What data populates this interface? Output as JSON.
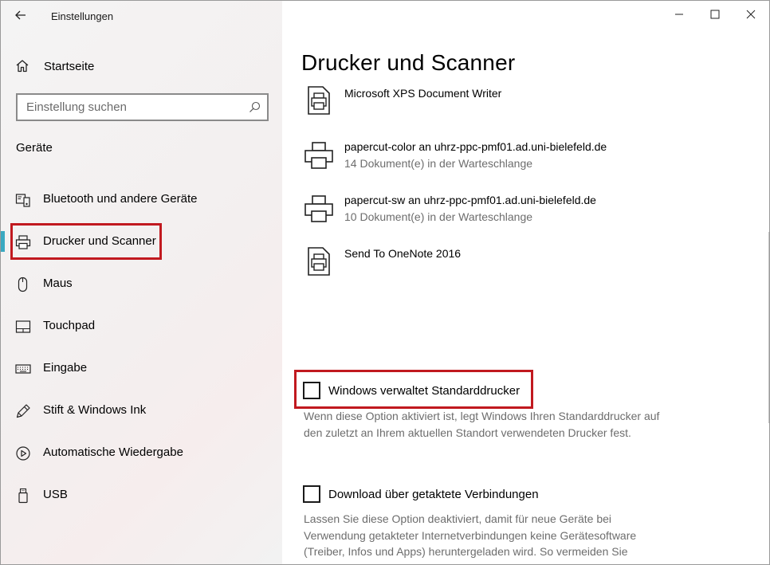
{
  "app": {
    "title": "Einstellungen",
    "back_icon": "arrow-left-icon"
  },
  "sidebar": {
    "home_label": "Startseite",
    "home_icon": "home-icon",
    "search_placeholder": "Einstellung suchen",
    "search_value": "",
    "search_icon": "search-icon",
    "section_heading": "Geräte",
    "items": [
      {
        "label": "Bluetooth und andere Geräte",
        "icon": "bluetooth-devices-icon",
        "active": false
      },
      {
        "label": "Drucker und Scanner",
        "icon": "printer-icon",
        "active": true
      },
      {
        "label": "Maus",
        "icon": "mouse-icon",
        "active": false
      },
      {
        "label": "Touchpad",
        "icon": "touchpad-icon",
        "active": false
      },
      {
        "label": "Eingabe",
        "icon": "keyboard-icon",
        "active": false
      },
      {
        "label": "Stift & Windows Ink",
        "icon": "pen-icon",
        "active": false
      },
      {
        "label": "Automatische Wiedergabe",
        "icon": "autoplay-icon",
        "active": false
      },
      {
        "label": "USB",
        "icon": "usb-icon",
        "active": false
      }
    ],
    "accent_color": "#3aa9c1",
    "highlight_color": "#c1191f"
  },
  "window_controls": {
    "minimize_icon": "minimize-icon",
    "maximize_icon": "maximize-icon",
    "close_icon": "close-icon"
  },
  "main": {
    "title": "Drucker und Scanner",
    "printers": [
      {
        "name": "Microsoft XPS Document Writer",
        "status": "",
        "icon": "document-printer-icon"
      },
      {
        "name": "papercut-color an uhrz-ppc-pmf01.ad.uni-bielefeld.de",
        "status": "14 Dokument(e) in der Warteschlange",
        "icon": "printer-icon"
      },
      {
        "name": "papercut-sw an uhrz-ppc-pmf01.ad.uni-bielefeld.de",
        "status": "10 Dokument(e) in der Warteschlange",
        "icon": "printer-icon"
      },
      {
        "name": "Send To OneNote 2016",
        "status": "",
        "icon": "document-printer-icon"
      }
    ],
    "options": [
      {
        "label": "Windows verwaltet Standarddrucker",
        "checked": false,
        "description_lines": [
          "Wenn diese Option aktiviert ist, legt Windows Ihren Standarddrucker auf",
          "den zuletzt an Ihrem aktuellen Standort verwendeten Drucker fest."
        ]
      },
      {
        "label": "Download über getaktete Verbindungen",
        "checked": false,
        "description_lines": [
          "Lassen Sie diese Option deaktiviert, damit für neue Geräte bei",
          "Verwendung getakteter Internetverbindungen keine Gerätesoftware",
          "(Treiber, Infos und Apps) heruntergeladen wird. So vermeiden Sie"
        ]
      }
    ]
  }
}
